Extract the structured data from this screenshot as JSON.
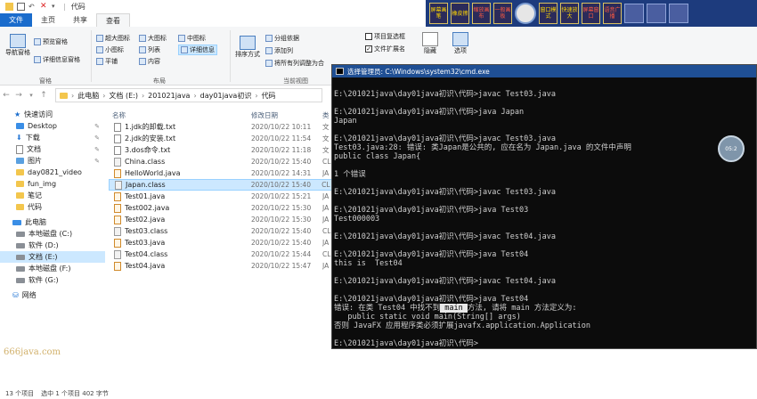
{
  "window": {
    "title": "代码",
    "quick_access_icons": [
      "folder-icon",
      "properties-icon",
      "undo-icon",
      "delete-icon",
      "dropdown-icon"
    ]
  },
  "tabs": [
    "文件",
    "主页",
    "共享",
    "查看"
  ],
  "ribbon": {
    "pane_group": {
      "nav_pane": "导航窗格",
      "preview_pane": "预览窗格",
      "details_pane": "详细信息窗格",
      "label": "窗格"
    },
    "layout_group": {
      "items": [
        "超大图标",
        "大图标",
        "中图标",
        "小图标",
        "列表",
        "详细信息",
        "平铺",
        "内容"
      ],
      "label": "布局"
    },
    "current_view": {
      "sort": "排序方式",
      "group_by": "分组依据",
      "add_column": "添加列",
      "fit_columns": "将所有列调整为合",
      "label": "当前视图"
    },
    "show_hide": {
      "item_checkboxes": "项目复选框",
      "file_extensions": "文件扩展名",
      "hide": "隐藏"
    },
    "options": "选项"
  },
  "address": {
    "crumbs": [
      "此电脑",
      "文档 (E:)",
      "201021java",
      "day01java初识",
      "代码"
    ]
  },
  "nav_pane": [
    {
      "label": "快速访问",
      "icon": "star-icon",
      "pinned": false
    },
    {
      "label": "Desktop",
      "icon": "folder-icon",
      "pinned": true
    },
    {
      "label": "下载",
      "icon": "download-icon",
      "pinned": true
    },
    {
      "label": "文档",
      "icon": "folder-icon",
      "pinned": true
    },
    {
      "label": "图片",
      "icon": "folder-icon",
      "pinned": true
    },
    {
      "label": "day0821_video",
      "icon": "folder-icon",
      "pinned": false
    },
    {
      "label": "fun_img",
      "icon": "folder-icon",
      "pinned": false
    },
    {
      "label": "笔记",
      "icon": "folder-icon",
      "pinned": false
    },
    {
      "label": "代码",
      "icon": "folder-icon",
      "pinned": false
    },
    {
      "label": "此电脑",
      "icon": "computer-icon",
      "pinned": false
    },
    {
      "label": "本地磁盘 (C:)",
      "icon": "drive-icon",
      "pinned": false
    },
    {
      "label": "软件 (D:)",
      "icon": "drive-icon",
      "pinned": false
    },
    {
      "label": "文档 (E:)",
      "icon": "drive-icon",
      "pinned": false,
      "selected": true
    },
    {
      "label": "本地磁盘 (F:)",
      "icon": "drive-icon",
      "pinned": false
    },
    {
      "label": "软件 (G:)",
      "icon": "drive-icon",
      "pinned": false
    },
    {
      "label": "网络",
      "icon": "network-icon",
      "pinned": false
    }
  ],
  "file_list": {
    "columns": [
      "名称",
      "修改日期",
      "类"
    ],
    "rows": [
      {
        "name": "1.jdk的卸载.txt",
        "date": "2020/10/22 10:11",
        "type": "文",
        "kind": "txt"
      },
      {
        "name": "2.jdk的安装.txt",
        "date": "2020/10/22 11:54",
        "type": "文",
        "kind": "txt"
      },
      {
        "name": "3.dos命令.txt",
        "date": "2020/10/22 11:18",
        "type": "文",
        "kind": "txt"
      },
      {
        "name": "China.class",
        "date": "2020/10/22 15:40",
        "type": "CL",
        "kind": "class"
      },
      {
        "name": "HelloWorld.java",
        "date": "2020/10/22 14:31",
        "type": "JA",
        "kind": "java"
      },
      {
        "name": "Japan.class",
        "date": "2020/10/22 15:40",
        "type": "CL",
        "kind": "class",
        "selected": true
      },
      {
        "name": "Test01.java",
        "date": "2020/10/22 15:21",
        "type": "JA",
        "kind": "java"
      },
      {
        "name": "Test002.java",
        "date": "2020/10/22 15:30",
        "type": "JA",
        "kind": "java"
      },
      {
        "name": "Test02.java",
        "date": "2020/10/22 15:30",
        "type": "JA",
        "kind": "java"
      },
      {
        "name": "Test03.class",
        "date": "2020/10/22 15:40",
        "type": "CL",
        "kind": "class"
      },
      {
        "name": "Test03.java",
        "date": "2020/10/22 15:40",
        "type": "JA",
        "kind": "java"
      },
      {
        "name": "Test04.class",
        "date": "2020/10/22 15:44",
        "type": "CL",
        "kind": "class"
      },
      {
        "name": "Test04.java",
        "date": "2020/10/22 15:47",
        "type": "JA",
        "kind": "java"
      }
    ]
  },
  "cmd": {
    "title": "选择管理员: C:\\Windows\\system32\\cmd.exe",
    "lines": [
      "",
      "E:\\201021java\\day01java初识\\代码>javac Test03.java",
      "",
      "E:\\201021java\\day01java初识\\代码>java Japan",
      "Japan",
      "",
      "E:\\201021java\\day01java初识\\代码>javac Test03.java",
      "Test03.java:28: 错误: 类Japan是公共的, 应在名为 Japan.java 的文件中声明",
      "public class Japan{",
      "",
      "1 个错误",
      "",
      "E:\\201021java\\day01java初识\\代码>javac Test03.java",
      "",
      "E:\\201021java\\day01java初识\\代码>java Test03",
      "Test000003",
      "",
      "E:\\201021java\\day01java初识\\代码>javac Test04.java",
      "",
      "E:\\201021java\\day01java初识\\代码>java Test04",
      "this is  Test04",
      "",
      "E:\\201021java\\day01java初识\\代码>javac Test04.java",
      "",
      "E:\\201021java\\day01java初识\\代码>java Test04"
    ],
    "error_prefix": "错误: 在类 Test04 中找不到",
    "error_highlight": " main ",
    "error_suffix": "方法, 请将 main 方法定义为:",
    "error_lines": [
      "   public static void main(String[] args)",
      "否则 JavaFX 应用程序类必须扩展javafx.application.Application",
      "",
      "E:\\201021java\\day01java初识\\代码>"
    ]
  },
  "toolstrip": {
    "buttons": [
      "屏幕画笔",
      "橡皮擦",
      "缩放画布",
      "一般画板",
      "窗口模式",
      "快速放大",
      "屏幕窗口",
      "语音广播"
    ]
  },
  "overlay_circle": "05:2",
  "watermark": "666java.com",
  "status": {
    "count": "13 个项目",
    "selected": "选中 1 个项目  402 字节"
  }
}
